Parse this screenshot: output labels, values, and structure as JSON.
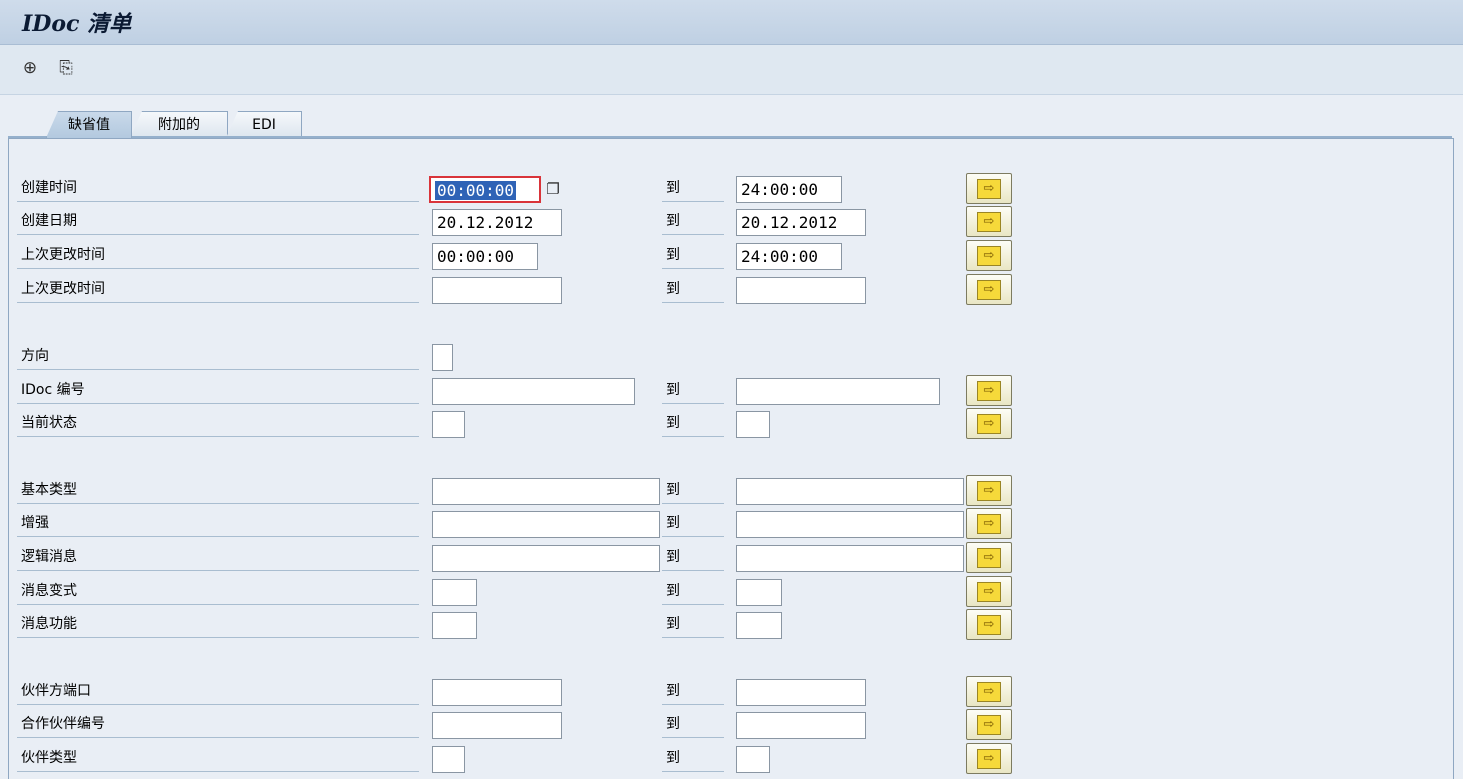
{
  "window": {
    "title": "IDoc 清单"
  },
  "toolbar": {
    "icons": [
      "execute-icon",
      "variant-icon"
    ]
  },
  "tabs": [
    {
      "label": "缺省值",
      "active": true
    },
    {
      "label": "附加的",
      "active": false
    },
    {
      "label": "EDI",
      "active": false
    }
  ],
  "to_label": "到",
  "rows": [
    {
      "label": "创建时间",
      "from": "00:00:00",
      "to": "24:00:00"
    },
    {
      "label": "创建日期",
      "from": "20.12.2012",
      "to": "20.12.2012"
    },
    {
      "label": "上次更改时间",
      "from": "00:00:00",
      "to": "24:00:00"
    },
    {
      "label": "上次更改时间",
      "from": "",
      "to": ""
    },
    {
      "label": "方向",
      "from": ""
    },
    {
      "label": "IDoc 编号",
      "from": "",
      "to": ""
    },
    {
      "label": "当前状态",
      "from": "",
      "to": ""
    },
    {
      "label": "基本类型",
      "from": "",
      "to": ""
    },
    {
      "label": "增强",
      "from": "",
      "to": ""
    },
    {
      "label": "逻辑消息",
      "from": "",
      "to": ""
    },
    {
      "label": "消息变式",
      "from": "",
      "to": ""
    },
    {
      "label": "消息功能",
      "from": "",
      "to": ""
    },
    {
      "label": "伙伴方端口",
      "from": "",
      "to": ""
    },
    {
      "label": "合作伙伴编号",
      "from": "",
      "to": ""
    },
    {
      "label": "伙伴类型",
      "from": "",
      "to": ""
    }
  ]
}
